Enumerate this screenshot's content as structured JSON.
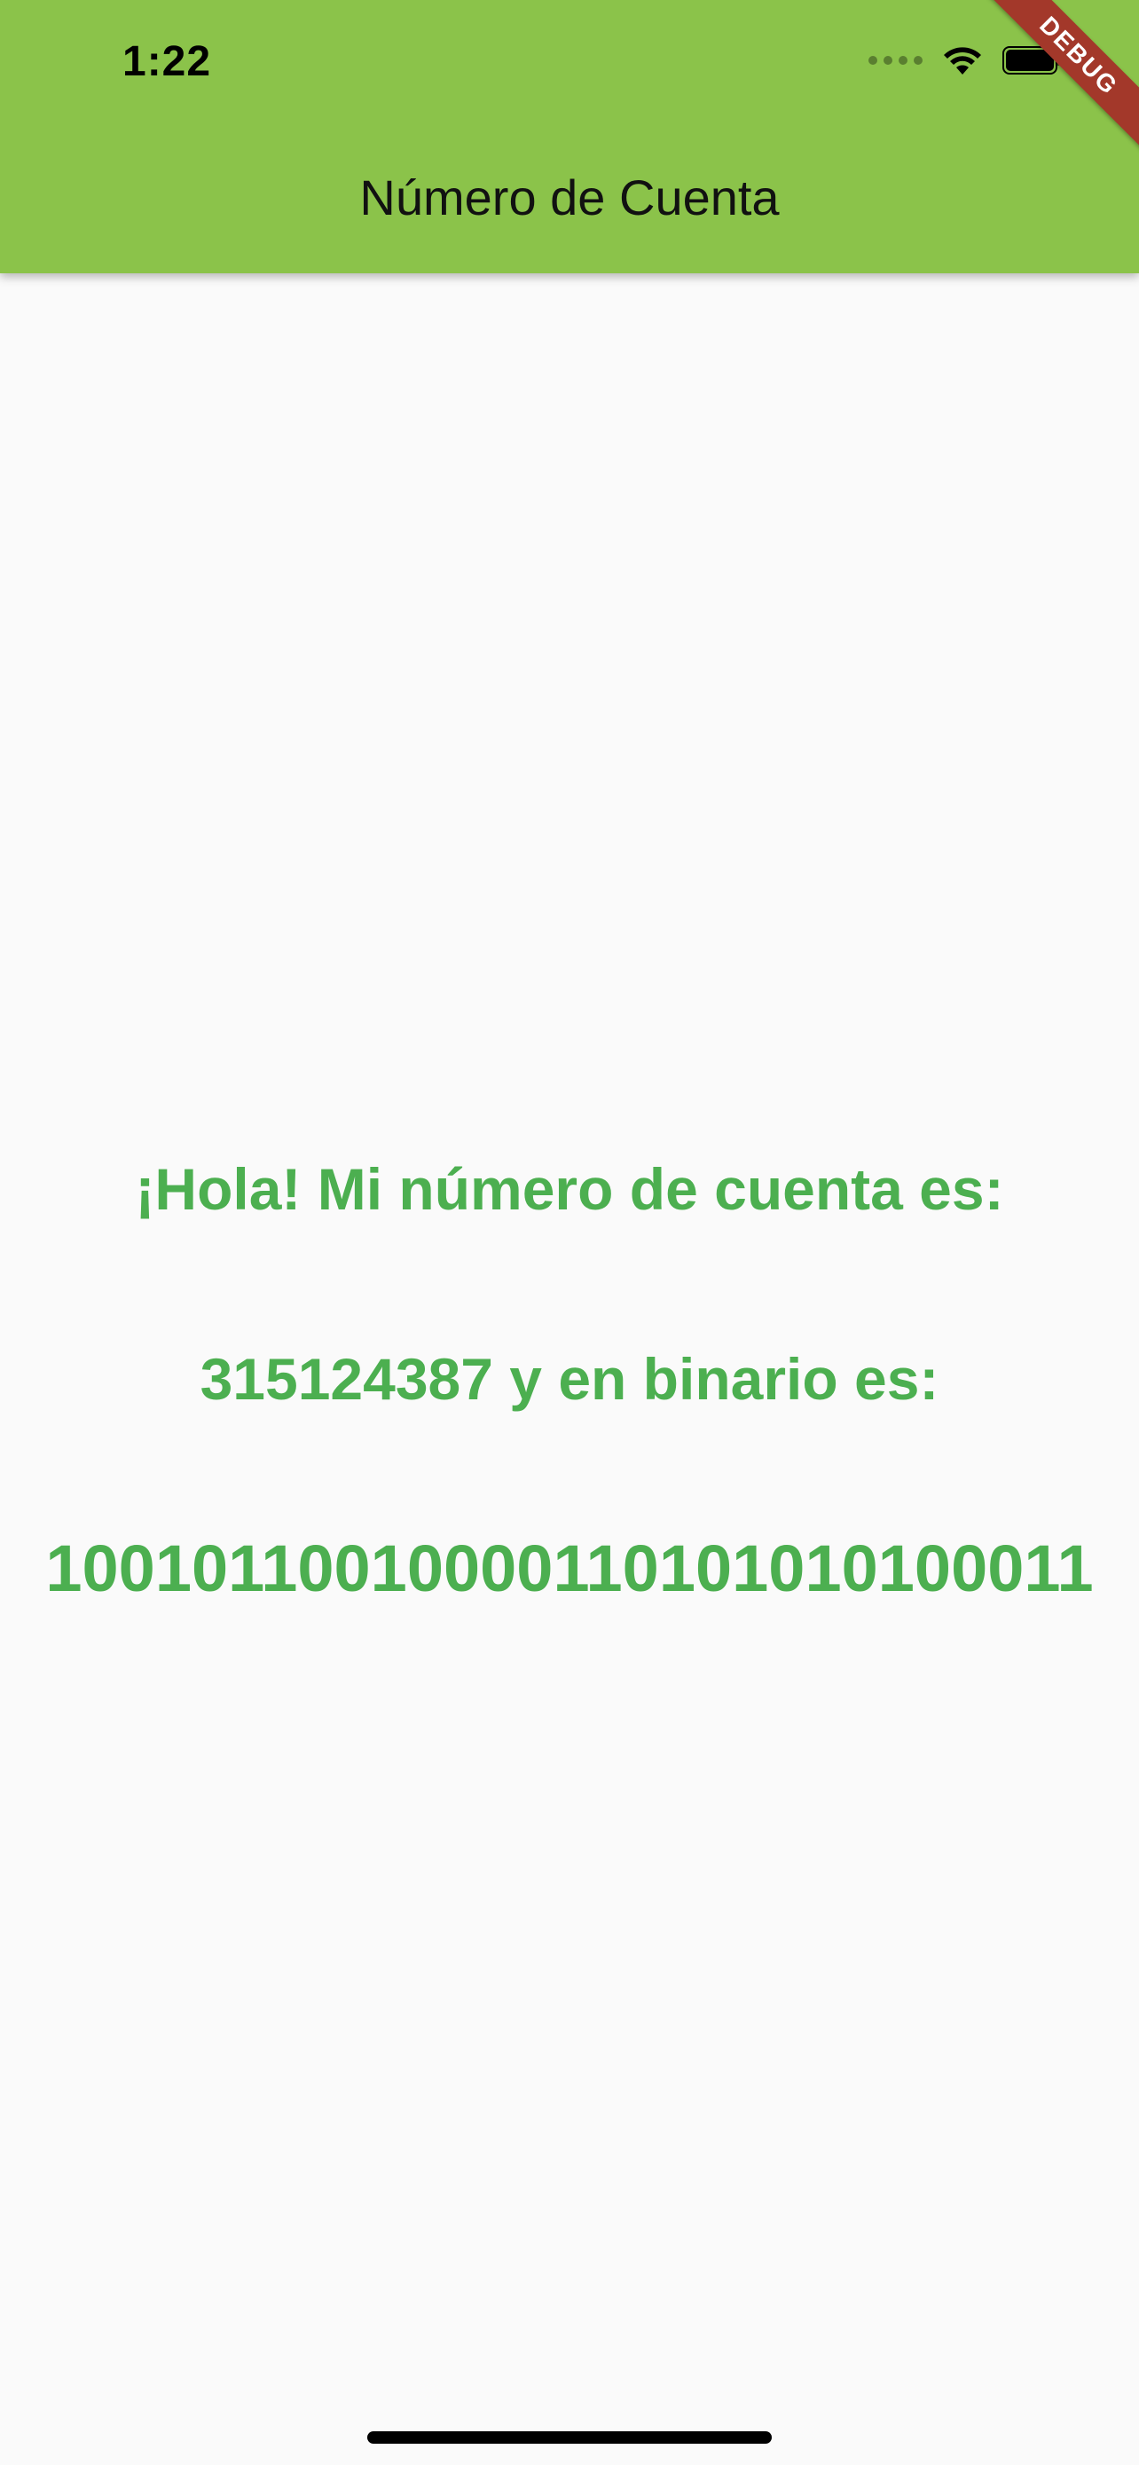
{
  "status_bar": {
    "time": "1:22"
  },
  "app_bar": {
    "title": "Número de Cuenta",
    "color": "#8bc34a"
  },
  "debug_banner": {
    "label": "DEBUG"
  },
  "content": {
    "greeting": "¡Hola! Mi número de cuenta es:",
    "account_line": "315124387  y en binario es:",
    "binary": "10010110010000110101010100011",
    "text_color": "#4caf50"
  },
  "icons": [
    "cellular-signal-icon",
    "wifi-icon",
    "battery-icon"
  ]
}
